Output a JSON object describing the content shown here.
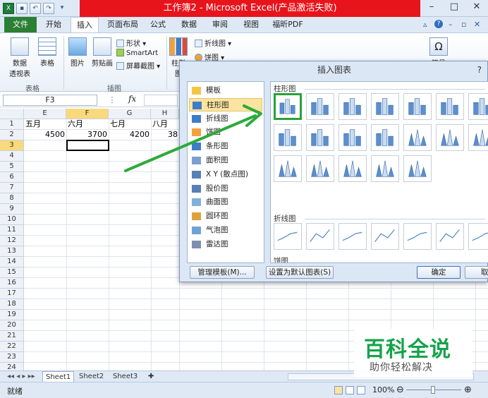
{
  "window": {
    "title": "工作簿2 - Microsoft Excel(产品激活失败)",
    "title_bar_color": "#e8141c",
    "controls": [
      "?",
      "–",
      "□",
      "✕"
    ]
  },
  "ribbon": {
    "tabs": [
      "文件",
      "开始",
      "插入",
      "页面布局",
      "公式",
      "数据",
      "审阅",
      "视图",
      "福昕PDF"
    ],
    "active_tab": "插入",
    "file_tab_color": "#2a7f33",
    "table_group": {
      "label": "表格",
      "pivot_line1": "数据",
      "pivot_line2": "透视表",
      "table": "表格"
    },
    "illustrations_group": {
      "label": "插图",
      "picture": "图片",
      "clipart": "剪贴画",
      "shapes": "形状",
      "smartart": "SmartArt",
      "screenshot": "屏幕截图"
    },
    "charts_group": {
      "column": "柱形图",
      "line": "折线图",
      "pie": "饼图"
    },
    "far_right": {
      "label": "符号"
    }
  },
  "formula_bar": {
    "name_box": "F3",
    "fx": "fx"
  },
  "grid": {
    "columns": [
      "E",
      "F",
      "G",
      "H"
    ],
    "selected_column": "F",
    "rows": [
      "1",
      "2",
      "3",
      "4",
      "5",
      "6",
      "7",
      "8",
      "9",
      "10",
      "11",
      "12",
      "13",
      "14",
      "15",
      "16",
      "17",
      "18",
      "19",
      "20",
      "21",
      "22",
      "23",
      "24"
    ],
    "selected_row": "3",
    "row1": [
      "五月",
      "六月",
      "七月",
      "八月"
    ],
    "row2": [
      "4500",
      "3700",
      "4200",
      "38"
    ]
  },
  "sheet_tabs": [
    "Sheet1",
    "Sheet2",
    "Sheet3"
  ],
  "status": {
    "ready": "就绪",
    "zoom": "100%"
  },
  "dialog": {
    "title": "插入图表",
    "help": "?",
    "categories": [
      "模板",
      "柱形图",
      "折线图",
      "饼图",
      "条形图",
      "面积图",
      "X Y (散点图)",
      "股价图",
      "曲面图",
      "圆环图",
      "气泡图",
      "雷达图"
    ],
    "selected_category": "柱形图",
    "sections": {
      "column": "柱形图",
      "line": "折线图",
      "pie": "饼图"
    },
    "buttons": {
      "manage_templates": "管理模板(M)...",
      "set_default": "设置为默认图表(S)",
      "ok": "确定",
      "cancel": "取消"
    }
  },
  "watermark": {
    "title": "百科全说",
    "subtitle": "助你轻松解决",
    "color": "#16a34a"
  },
  "annotation_arrow_color": "#2eaa3a"
}
